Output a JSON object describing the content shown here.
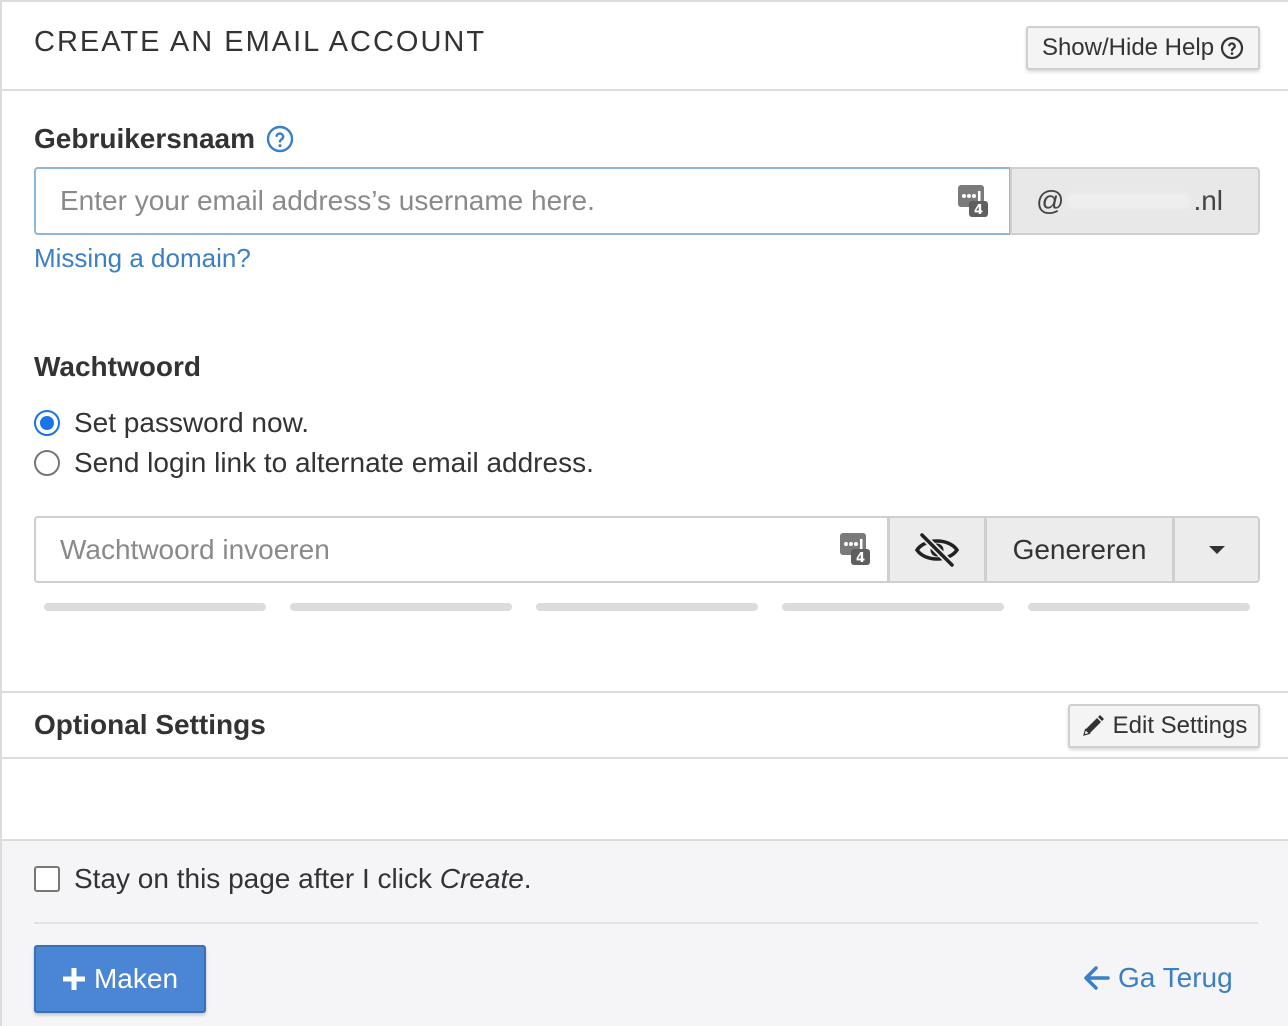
{
  "header": {
    "title": "CREATE AN EMAIL ACCOUNT",
    "help_button": "Show/Hide Help"
  },
  "username": {
    "label": "Gebruikersnaam",
    "placeholder": "Enter your email address’s username here.",
    "value": "",
    "domain_prefix": "@",
    "domain_suffix": ".nl",
    "missing_domain_link": "Missing a domain?",
    "password_manager_badge": "4"
  },
  "password": {
    "label": "Wachtwoord",
    "options": [
      {
        "label": "Set password now.",
        "checked": true
      },
      {
        "label": "Send login link to alternate email address.",
        "checked": false
      }
    ],
    "placeholder": "Wachtwoord invoeren",
    "value": "",
    "password_manager_badge": "4",
    "generate_button": "Genereren",
    "strength_segments": 5,
    "strength_filled": 0
  },
  "optional_settings": {
    "title": "Optional Settings",
    "edit_button": "Edit Settings"
  },
  "footer": {
    "stay_label_before": "Stay on this page after I click ",
    "stay_label_emph": "Create",
    "stay_label_after": ".",
    "stay_checked": false,
    "create_button": "Maken",
    "back_link": "Ga Terug"
  },
  "colors": {
    "accent": "#4a86d4",
    "link": "#3b7fc4",
    "radio": "#1a73e8"
  },
  "icons": [
    "help-circle-icon",
    "password-manager-icon",
    "eye-slash-icon",
    "caret-down-icon",
    "pencil-icon",
    "plus-icon",
    "arrow-left-icon"
  ]
}
